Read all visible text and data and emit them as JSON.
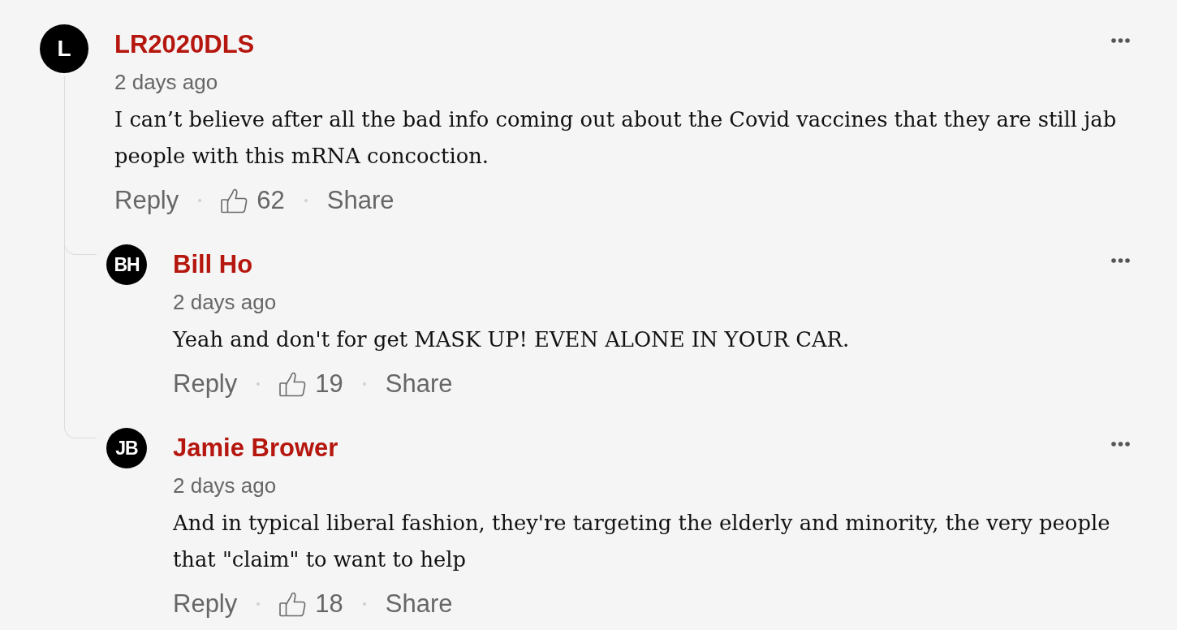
{
  "comments": [
    {
      "avatar": "L",
      "author": "LR2020DLS",
      "time": "2 days ago",
      "text": "I can’t believe after all the bad info coming out about the Covid vaccines that they are still jab people with this mRNA concoction.",
      "reply_label": "Reply",
      "likes": "62",
      "share_label": "Share",
      "replies": [
        {
          "avatar": "BH",
          "author": "Bill Ho",
          "time": "2 days ago",
          "text": "Yeah and don't for get MASK UP! EVEN ALONE IN YOUR CAR.",
          "reply_label": "Reply",
          "likes": "19",
          "share_label": "Share"
        },
        {
          "avatar": "JB",
          "author": "Jamie Brower",
          "time": "2 days ago",
          "text": "And in typical liberal fashion, they're targeting the elderly and minority, the very people that \"claim\" to want to help",
          "reply_label": "Reply",
          "likes": "18",
          "share_label": "Share"
        }
      ]
    }
  ]
}
